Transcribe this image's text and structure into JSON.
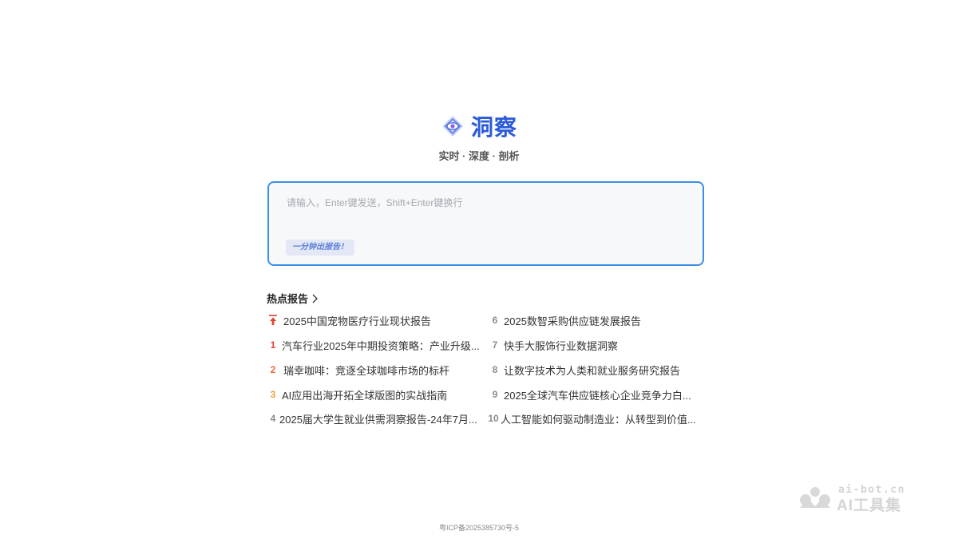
{
  "brand": {
    "name": "洞察",
    "tagline": "实时 · 深度 · 剖析",
    "accent_color": "#2a5bd7",
    "logo_icon": "eye-diamond-icon"
  },
  "composer": {
    "placeholder": "请输入，Enter键发送，Shift+Enter键换行",
    "value": "",
    "quick_action_label": "一分钟出报告！",
    "border_color": "#3c8fe6"
  },
  "hot_reports": {
    "title": "热点报告",
    "items": [
      {
        "rank": "",
        "icon": "pin-top-icon",
        "title": "2025中国宠物医疗行业现状报告",
        "rank_color": "#e0442e"
      },
      {
        "rank": "1",
        "title": "汽车行业2025年中期投资策略：产业升级...",
        "rank_color": "#e0442e"
      },
      {
        "rank": "2",
        "title": "瑞幸咖啡：竞逐全球咖啡市场的标杆",
        "rank_color": "#e96a3a"
      },
      {
        "rank": "3",
        "title": "AI应用出海开拓全球版图的实战指南",
        "rank_color": "#f0a03c"
      },
      {
        "rank": "4",
        "title": "2025届大学生就业供需洞察报告-24年7月...",
        "rank_color": "#8c8c8c"
      },
      {
        "rank": "6",
        "title": "2025数智采购供应链发展报告",
        "rank_color": "#8c8c8c"
      },
      {
        "rank": "7",
        "title": "快手大服饰行业数据洞察",
        "rank_color": "#8c8c8c"
      },
      {
        "rank": "8",
        "title": "让数字技术为人类和就业服务研究报告",
        "rank_color": "#8c8c8c"
      },
      {
        "rank": "9",
        "title": "2025全球汽车供应链核心企业竞争力白...",
        "rank_color": "#8c8c8c"
      },
      {
        "rank": "10",
        "title": "人工智能如何驱动制造业：从转型到价值...",
        "rank_color": "#8c8c8c"
      }
    ]
  },
  "footer": {
    "icp": "粤ICP备2025385730号-5"
  },
  "watermark": {
    "url": "ai-bot.cn",
    "name": "AI工具集"
  }
}
